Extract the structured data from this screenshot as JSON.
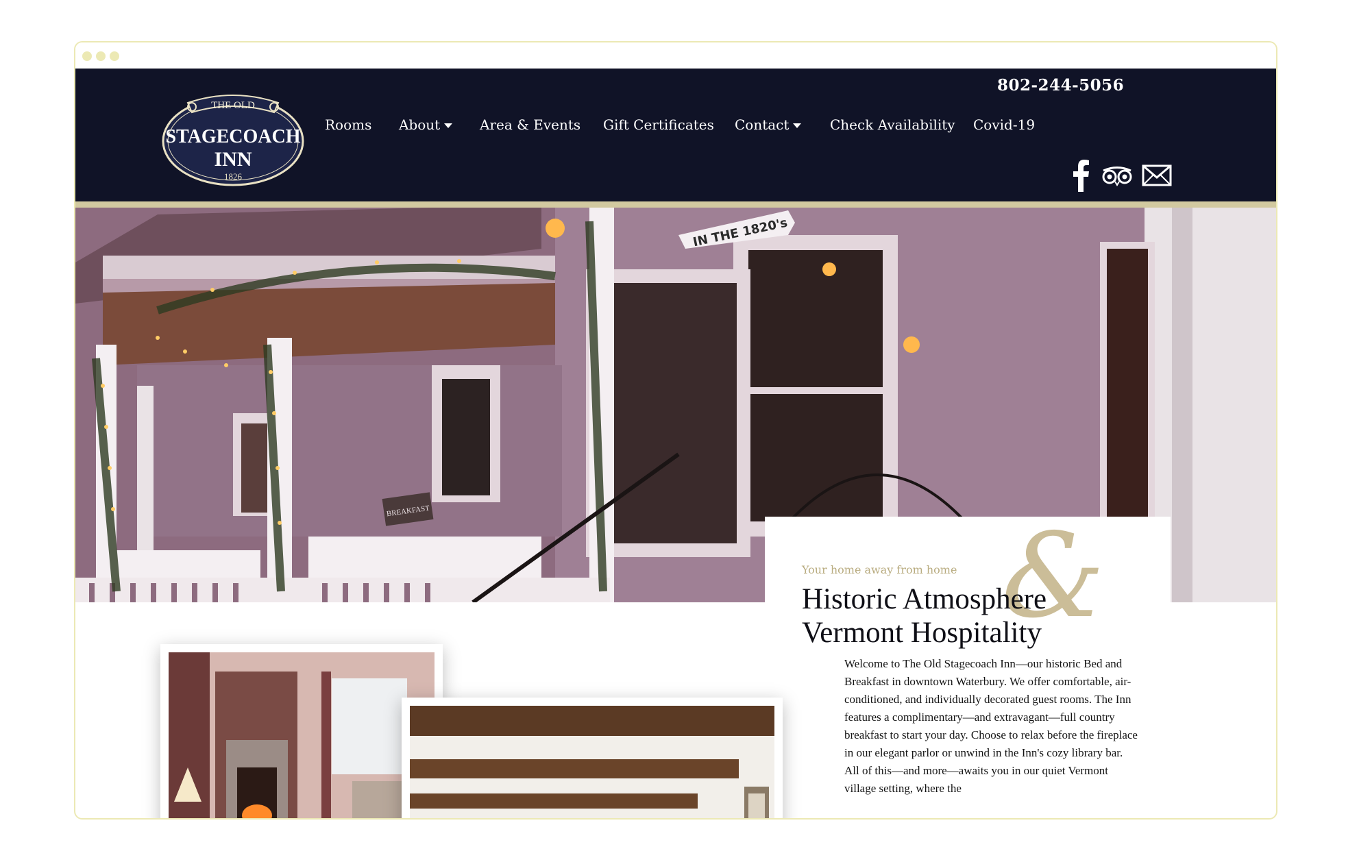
{
  "window": {
    "dots": [
      "dot",
      "dot",
      "dot"
    ]
  },
  "header": {
    "phone": "802-244-5056",
    "logo": {
      "top_text": "THE OLD",
      "name_line1": "STAGECOACH",
      "name_line2": "INN",
      "year": "1826"
    },
    "nav": [
      {
        "label": "Rooms",
        "dropdown": false
      },
      {
        "label": "About",
        "dropdown": true
      },
      {
        "label": "Area & Events",
        "dropdown": false
      },
      {
        "label": "Gift Certificates",
        "dropdown": false
      },
      {
        "label": "Contact",
        "dropdown": true
      },
      {
        "label": "Check Availability",
        "dropdown": false
      },
      {
        "label": "Covid-19",
        "dropdown": false
      }
    ],
    "social": [
      "facebook-icon",
      "tripadvisor-icon",
      "email-icon"
    ]
  },
  "hero": {
    "sign_text": "IN THE 1820's",
    "breakfast_sign": "BREAKFAST"
  },
  "intro": {
    "kicker": "Your home away from home",
    "ampersand": "&",
    "headline_line1": "Historic Atmosphere",
    "headline_line2": "Vermont Hospitality",
    "body": "Welcome to The Old Stagecoach Inn—our historic Bed and Breakfast in downtown Waterbury. We offer comfortable, air-conditioned, and individually decorated guest rooms. The Inn features a complimentary—and extravagant—full country breakfast to start your day. Choose to relax before the fireplace in our elegant parlor or unwind in the Inn's cozy library bar. All of this—and more—awaits you in our quiet Vermont village setting, where the"
  },
  "colors": {
    "header_bg": "#101327",
    "accent_gold": "#c6b68d",
    "header_border": "#d2c9a0"
  }
}
